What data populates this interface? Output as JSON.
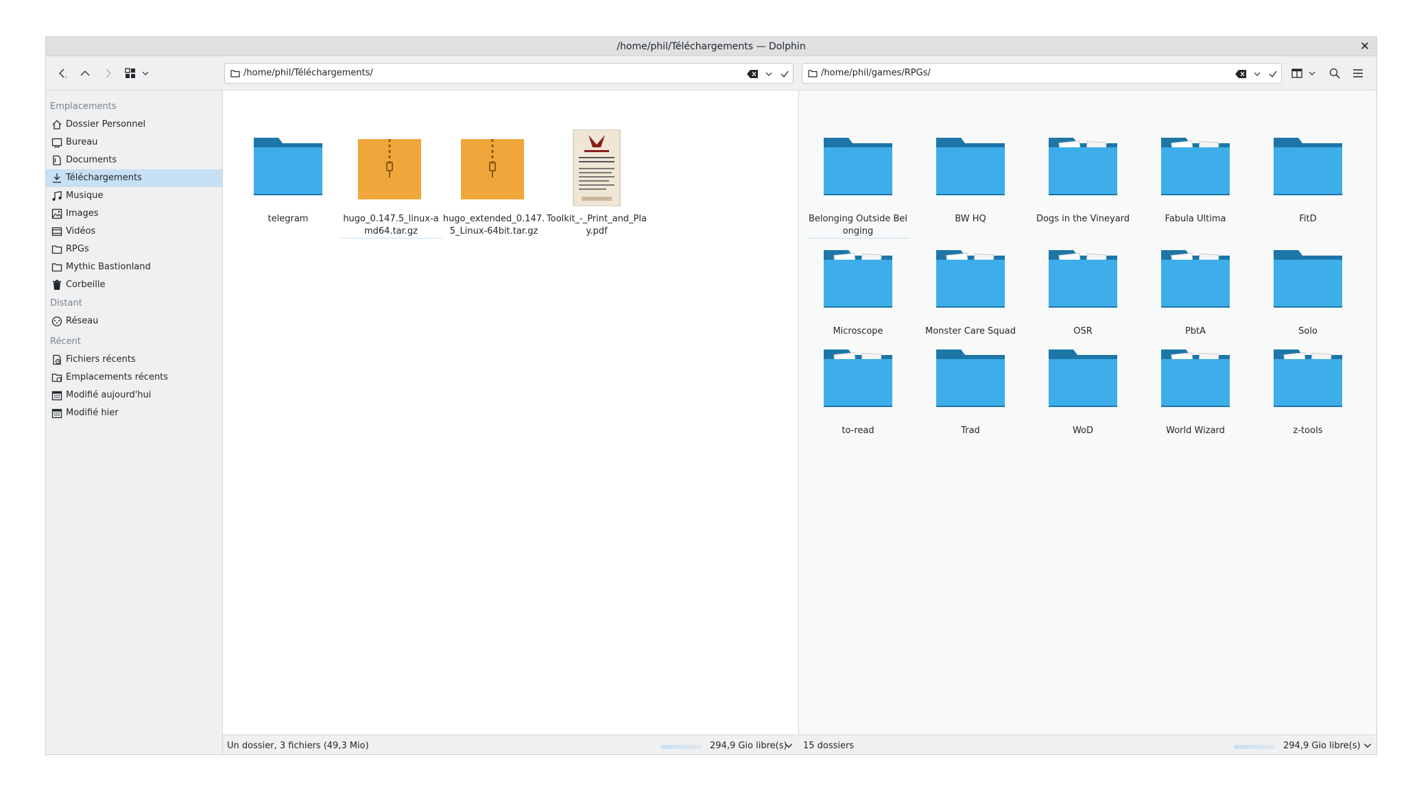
{
  "window": {
    "title": "/home/phil/Téléchargements — Dolphin"
  },
  "toolbar": {
    "back_icon": "go-previous-icon",
    "up_icon": "go-up-icon",
    "forward_icon": "go-next-icon",
    "view_mode_icon": "view-icons-icon",
    "split_icon": "view-split-icon",
    "search_icon": "search-icon",
    "menu_icon": "hamburger-menu-icon"
  },
  "left_location": {
    "path": "/home/phil/Téléchargements/"
  },
  "right_location": {
    "path": "/home/phil/games/RPGs/"
  },
  "sidebar": {
    "sections": [
      {
        "title": "Emplacements",
        "items": [
          {
            "label": "Dossier Personnel",
            "icon": "home-icon"
          },
          {
            "label": "Bureau",
            "icon": "desktop-icon"
          },
          {
            "label": "Documents",
            "icon": "documents-icon"
          },
          {
            "label": "Téléchargements",
            "icon": "download-icon",
            "selected": true
          },
          {
            "label": "Musique",
            "icon": "music-icon"
          },
          {
            "label": "Images",
            "icon": "images-icon"
          },
          {
            "label": "Vidéos",
            "icon": "videos-icon"
          },
          {
            "label": "RPGs",
            "icon": "folder-icon"
          },
          {
            "label": "Mythic Bastionland",
            "icon": "folder-icon"
          },
          {
            "label": "Corbeille",
            "icon": "trash-icon"
          }
        ]
      },
      {
        "title": "Distant",
        "items": [
          {
            "label": "Réseau",
            "icon": "network-icon"
          }
        ]
      },
      {
        "title": "Récent",
        "items": [
          {
            "label": "Fichiers récents",
            "icon": "recent-files-icon"
          },
          {
            "label": "Emplacements récents",
            "icon": "recent-places-icon"
          },
          {
            "label": "Modifié aujourd'hui",
            "icon": "calendar-icon"
          },
          {
            "label": "Modifié hier",
            "icon": "calendar-icon"
          }
        ]
      }
    ]
  },
  "left_pane": {
    "items": [
      {
        "name": "telegram",
        "type": "folder"
      },
      {
        "name": "hugo_0.147.5_linux-amd64.tar.gz",
        "type": "archive"
      },
      {
        "name": "hugo_extended_0.147.5_Linux-64bit.tar.gz",
        "type": "archive"
      },
      {
        "name": "Toolkit_-_Print_and_Play.pdf",
        "type": "pdf"
      }
    ],
    "status": "Un dossier, 3 fichiers (49,3 Mio)",
    "free_space": "294,9 Gio libre(s)"
  },
  "right_pane": {
    "items": [
      {
        "name": "Belonging Outside Belonging",
        "type": "folder"
      },
      {
        "name": "BW HQ",
        "type": "folder"
      },
      {
        "name": "Dogs in the Vineyard",
        "type": "folder-preview"
      },
      {
        "name": "Fabula Ultima",
        "type": "folder-preview"
      },
      {
        "name": "FitD",
        "type": "folder"
      },
      {
        "name": "Microscope",
        "type": "folder-preview"
      },
      {
        "name": "Monster Care Squad",
        "type": "folder-preview"
      },
      {
        "name": "OSR",
        "type": "folder-preview"
      },
      {
        "name": "PbtA",
        "type": "folder-preview"
      },
      {
        "name": "Solo",
        "type": "folder"
      },
      {
        "name": "to-read",
        "type": "folder-preview"
      },
      {
        "name": "Trad",
        "type": "folder"
      },
      {
        "name": "WoD",
        "type": "folder"
      },
      {
        "name": "World Wizard",
        "type": "folder-preview"
      },
      {
        "name": "z-tools",
        "type": "folder-preview"
      }
    ],
    "status": "15 dossiers",
    "free_space": "294,9 Gio libre(s)"
  },
  "colors": {
    "folder": "#3daee9",
    "folder_dark": "#1d76a8",
    "archive": "#f0a63a",
    "selection": "#c7e0f4"
  }
}
